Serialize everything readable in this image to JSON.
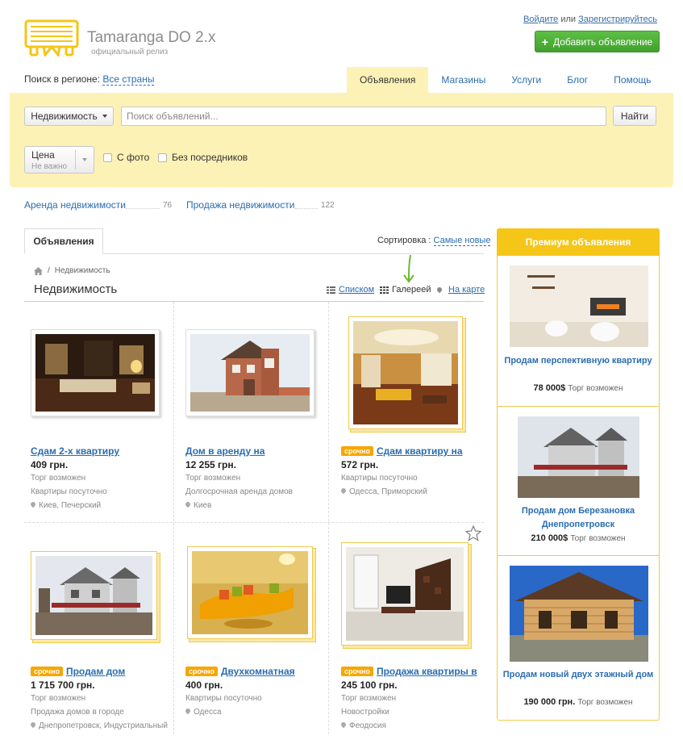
{
  "header": {
    "logo_title": "Tamaranga DO 2.x",
    "logo_subtitle": "официальный релиз",
    "login": "Войдите",
    "or": "или",
    "register": "Зарегистрируйтесь",
    "add_button": "Добавить объявление"
  },
  "region": {
    "label": "Поиск в регионе:",
    "value": "Все страны"
  },
  "nav": {
    "tabs": [
      "Объявления",
      "Магазины",
      "Услуги",
      "Блог",
      "Помощь"
    ],
    "active": "Объявления"
  },
  "search": {
    "category": "Недвижимость",
    "placeholder": "Поиск объявлений...",
    "find": "Найти",
    "price_label": "Цена",
    "price_sub": "Не важно",
    "with_photo": "С фото",
    "no_agents": "Без посредников"
  },
  "categories": [
    {
      "name": "Аренда недвижимости",
      "count": "76"
    },
    {
      "name": "Продажа недвижимости",
      "count": "122"
    }
  ],
  "listing": {
    "tab": "Объявления",
    "sort_label": "Сортировка :",
    "sort_value": "Самые новые",
    "breadcrumb": "Недвижимость",
    "title": "Недвижимость",
    "view_list": "Списком",
    "view_gallery": "Галереей",
    "view_map": "На карте"
  },
  "items": [
    {
      "title": "Сдам 2-х квартиру",
      "urgent": "",
      "price": "409 грн.",
      "bargain": "Торг возможен",
      "category": "Квартиры посуточно",
      "location": "Киев, Печерский"
    },
    {
      "title": "Дом в аренду на",
      "urgent": "",
      "price": "12 255 грн.",
      "bargain": "Торг возможен",
      "category": "Долгосрочная аренда домов",
      "location": "Киев"
    },
    {
      "title": "Сдам квартиру на",
      "urgent": "срочно",
      "price": "572 грн.",
      "bargain": "",
      "category": "Квартиры посуточно",
      "location": "Одесса, Приморский"
    },
    {
      "title": "Продам дом",
      "urgent": "срочно",
      "price": "1 715 700 грн.",
      "bargain": "Торг возможен",
      "category": "Продажа домов в городе",
      "location": "Днепропетровск, Индустриальный"
    },
    {
      "title": "Двухкомнатная",
      "urgent": "срочно",
      "price": "400 грн.",
      "bargain": "",
      "category": "Квартиры посуточно",
      "location": "Одесса"
    },
    {
      "title": "Продажа квартиры в",
      "urgent": "срочно",
      "price": "245 100 грн.",
      "bargain": "Торг возможен",
      "category": "Новостройки",
      "location": "Феодосия"
    }
  ],
  "premium": {
    "header": "Премиум объявления",
    "items": [
      {
        "title": "Продам перспективную квартиру",
        "price": "78 000$",
        "note": "Торг возможен"
      },
      {
        "title": "Продам дом Березановка Днепропетровск",
        "price": "210 000$",
        "note": "Торг возможен"
      },
      {
        "title": "Продам новый двух этажный дом",
        "price": "190 000 грн.",
        "note": "Торг возможен"
      }
    ]
  },
  "colors": {
    "accent_yellow": "#f5c518",
    "panel": "#fdf2b6",
    "link": "#2a6db0",
    "green_button": "#4caf35",
    "urgent_badge": "#f7a600"
  }
}
